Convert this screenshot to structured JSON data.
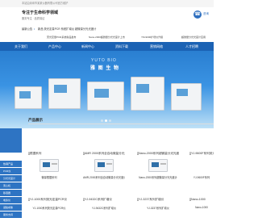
{
  "topbar": {
    "text": "本站由深圳市某某仪器有限公司官方维护"
  },
  "header": {
    "logo_text": "专注于生命科学领域",
    "logo_sub": "服务专注 · 品质保证",
    "phone_icon": "phone-icon",
    "phone_text": "咨询"
  },
  "ticker": {
    "label": "最新公告",
    "bullet": "•",
    "text": "新品 荧光定量PCR 系统扩增仪 超微量分光光度计"
  },
  "news": {
    "items": [
      "荧光定量PCR系统新品发布",
      "Nano-2000超微量分光光度计上市",
      "YM-9000扩增仪升级",
      "超微量分光光度计应用"
    ]
  },
  "nav": {
    "items": [
      "关于我们",
      "产品中心",
      "新闻中心",
      "资料下载",
      "营销网络",
      "人才招聘"
    ]
  },
  "banner": {
    "title_en": "YUTO BIO",
    "title_cn": "雅 图 生 物"
  },
  "section": {
    "title": "产品展示"
  },
  "sidebar": {
    "items": [
      "热销产品",
      "PCR仪",
      "分光光度计",
      "离心机",
      "移液器",
      "电泳仪",
      "凝胶成像",
      "服务支持"
    ]
  },
  "products": [
    {
      "caption": "[]根据系列",
      "sub": "微量根据系列"
    },
    {
      "caption": "[]AMR 2000系列全自动微量分光光度计",
      "sub": "AMR-2000系列全自动微量分光光度计"
    },
    {
      "caption": "[]Nano-2000系列超微量分光光度计",
      "sub": "Nano-2000系列超微量分光光度计"
    },
    {
      "caption": "[]YJ-9600F系列荧光定量PCR仪",
      "sub": "YJ-9600F系列"
    },
    {
      "caption": "[]YJ-1000系列荧光定量PCR仪",
      "sub": "YJ-1000系列荧光定量PCR仪"
    },
    {
      "caption": "[]YJ-9432C系列扩增仪",
      "sub": "YJ-9432C系列扩增仪"
    },
    {
      "caption": "[]YJ-3237系列扩增仪",
      "sub": "YJ-3237系列扩增仪"
    },
    {
      "caption": "[]Nano-1000",
      "sub": "Nano-1000"
    }
  ],
  "colors": {
    "nav": "#1b62b4",
    "accent": "#2e6fbf",
    "sidebar": "#2e74c3"
  }
}
